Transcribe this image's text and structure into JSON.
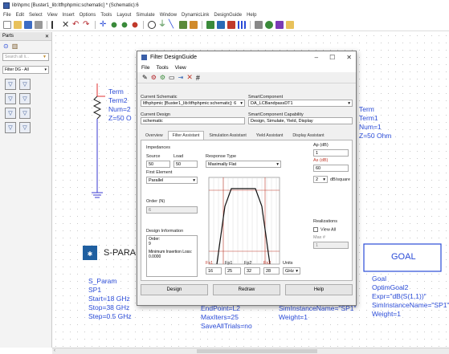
{
  "window": {
    "title": "lib\\hpmc [Buster1_lib:ltfhphpmic:schematic] * (Schematic):6"
  },
  "menu": [
    "File",
    "Edit",
    "Select",
    "View",
    "Insert",
    "Options",
    "Tools",
    "Layout",
    "Simulate",
    "Window",
    "DynamicLink",
    "DesignGuide",
    "Help"
  ],
  "panel": {
    "title": "Parts",
    "search_placeholder": "Search all li...",
    "category": "Filter DG - All"
  },
  "schematic": {
    "term_left": [
      "Term",
      "Term2",
      "Num=2",
      "Z=50 O"
    ],
    "term_right": [
      "Term",
      "Term1",
      "Num=1",
      "Z=50 Ohm"
    ],
    "sparam_title": "S-PARA",
    "sparam_lines": [
      "S_Param",
      "SP1",
      "Start=18 GHz",
      "Stop=38 GHz",
      "Step=0.5 GHz"
    ],
    "optim_lines": [
      "EndPoint=L2",
      "MaxIters=25",
      "SaveAllTrials=no"
    ],
    "mid_lines": [
      "SimInstanceName=\"SP1\"",
      "Weight=1"
    ],
    "goal_title": "GOAL",
    "goal_lines": [
      "Goal",
      "OptimGoal2",
      "Expr=\"dB(S(1,1))\"",
      "SimInstanceName=\"SP1\"",
      "Weight=1"
    ]
  },
  "dialog": {
    "title": "Filter DesignGuide",
    "menu": [
      "File",
      "Tools",
      "View"
    ],
    "current_schematic_label": "Current Schematic",
    "current_schematic_value": "ltfhphpmic [Buster1_lib:ltfhphpmic:schematic]: 6",
    "smart_component_label": "SmartComponent",
    "smart_component_value": "DA_LCBandpassDT1",
    "current_design_label": "Current Design",
    "current_design_value": "schematic",
    "capability_label": "SmartComponent Capability",
    "capability_value": "Design, Simulate, Yield, Display",
    "tabs": [
      "Overview",
      "Filter Assistant",
      "Simulation Assistant",
      "Yield Assistant",
      "Display Assistant"
    ],
    "impedances_label": "Impedances",
    "source_label": "Source",
    "load_label": "Load",
    "source_value": "50",
    "load_value": "50",
    "first_element_label": "First Element",
    "first_element_value": "Parallel",
    "response_type_label": "Response Type",
    "response_type_value": "Maximally Flat",
    "ap_label": "Ap (dB)",
    "ap_value": "1",
    "as_label": "As (dB)",
    "as_value": "60",
    "db_square_value": "2",
    "db_square_unit": "dB/square",
    "order_label": "Order (N)",
    "order_value": "6",
    "design_info_label": "Design Information",
    "design_info_text": [
      "Order:",
      "9",
      "",
      "Minimum Insertion Loss:",
      "0.0000"
    ],
    "realizations_label": "Realizations",
    "view_all_label": "View All",
    "max_label": "Max #",
    "max_value": "1",
    "freq_labels": [
      "Fs1",
      "Fp1",
      "Fp2",
      "Fs2",
      "Units"
    ],
    "freq_values": [
      "16",
      "25",
      "32",
      "28",
      "GHz"
    ],
    "buttons": [
      "Design",
      "Redraw",
      "Help"
    ]
  },
  "colors": {
    "schematic_text": "#2a4bd7",
    "accent": "#3a5fa8"
  }
}
